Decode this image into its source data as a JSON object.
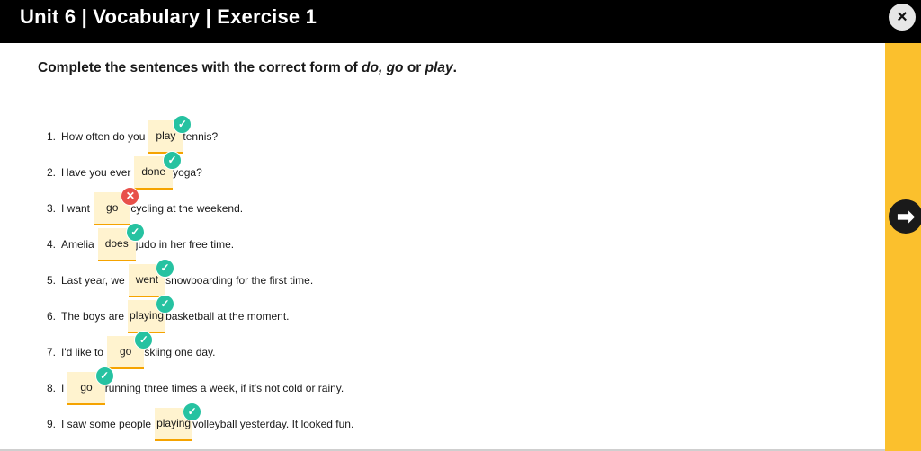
{
  "header": {
    "title": "Unit 6 | Vocabulary | Exercise 1",
    "close_icon": "×"
  },
  "instruction": {
    "prefix": "Complete the sentences with the correct form of ",
    "words": "do, go",
    "or_text": " or ",
    "last_word": "play",
    "end": "."
  },
  "nav": {
    "next_icon": "➡"
  },
  "colors": {
    "header": "#000000",
    "side_panel": "#fbc02d",
    "correct": "#26c2a1",
    "incorrect": "#e8504a",
    "gap_fill": "#fff3cf",
    "gap_underline": "#f5a300"
  },
  "items": [
    {
      "num": "1.",
      "before": "How often do you",
      "answer": "play",
      "after": "tennis?",
      "status": "correct",
      "status_icon": "✓"
    },
    {
      "num": "2.",
      "before": "Have you ever",
      "answer": "done",
      "after": "yoga?",
      "status": "correct",
      "status_icon": "✓"
    },
    {
      "num": "3.",
      "before": "I want",
      "answer": "go",
      "after": "cycling at the weekend.",
      "status": "incorrect",
      "status_icon": "✕"
    },
    {
      "num": "4.",
      "before": "Amelia",
      "answer": "does",
      "after": "judo in her free time.",
      "status": "correct",
      "status_icon": "✓"
    },
    {
      "num": "5.",
      "before": "Last year, we",
      "answer": "went",
      "after": "snowboarding for the first time.",
      "status": "correct",
      "status_icon": "✓"
    },
    {
      "num": "6.",
      "before": "The boys are",
      "answer": "playing",
      "after": "basketball at the moment.",
      "status": "correct",
      "status_icon": "✓"
    },
    {
      "num": "7.",
      "before": "I'd like to",
      "answer": "go",
      "after": "skiing one day.",
      "status": "correct",
      "status_icon": "✓"
    },
    {
      "num": "8.",
      "before": "I",
      "answer": "go",
      "after": "running three times a week, if it's not cold or rainy.",
      "status": "correct",
      "status_icon": "✓"
    },
    {
      "num": "9.",
      "before": "I saw some people",
      "answer": "playing",
      "after": "volleyball yesterday. It looked fun.",
      "status": "correct",
      "status_icon": "✓"
    }
  ]
}
